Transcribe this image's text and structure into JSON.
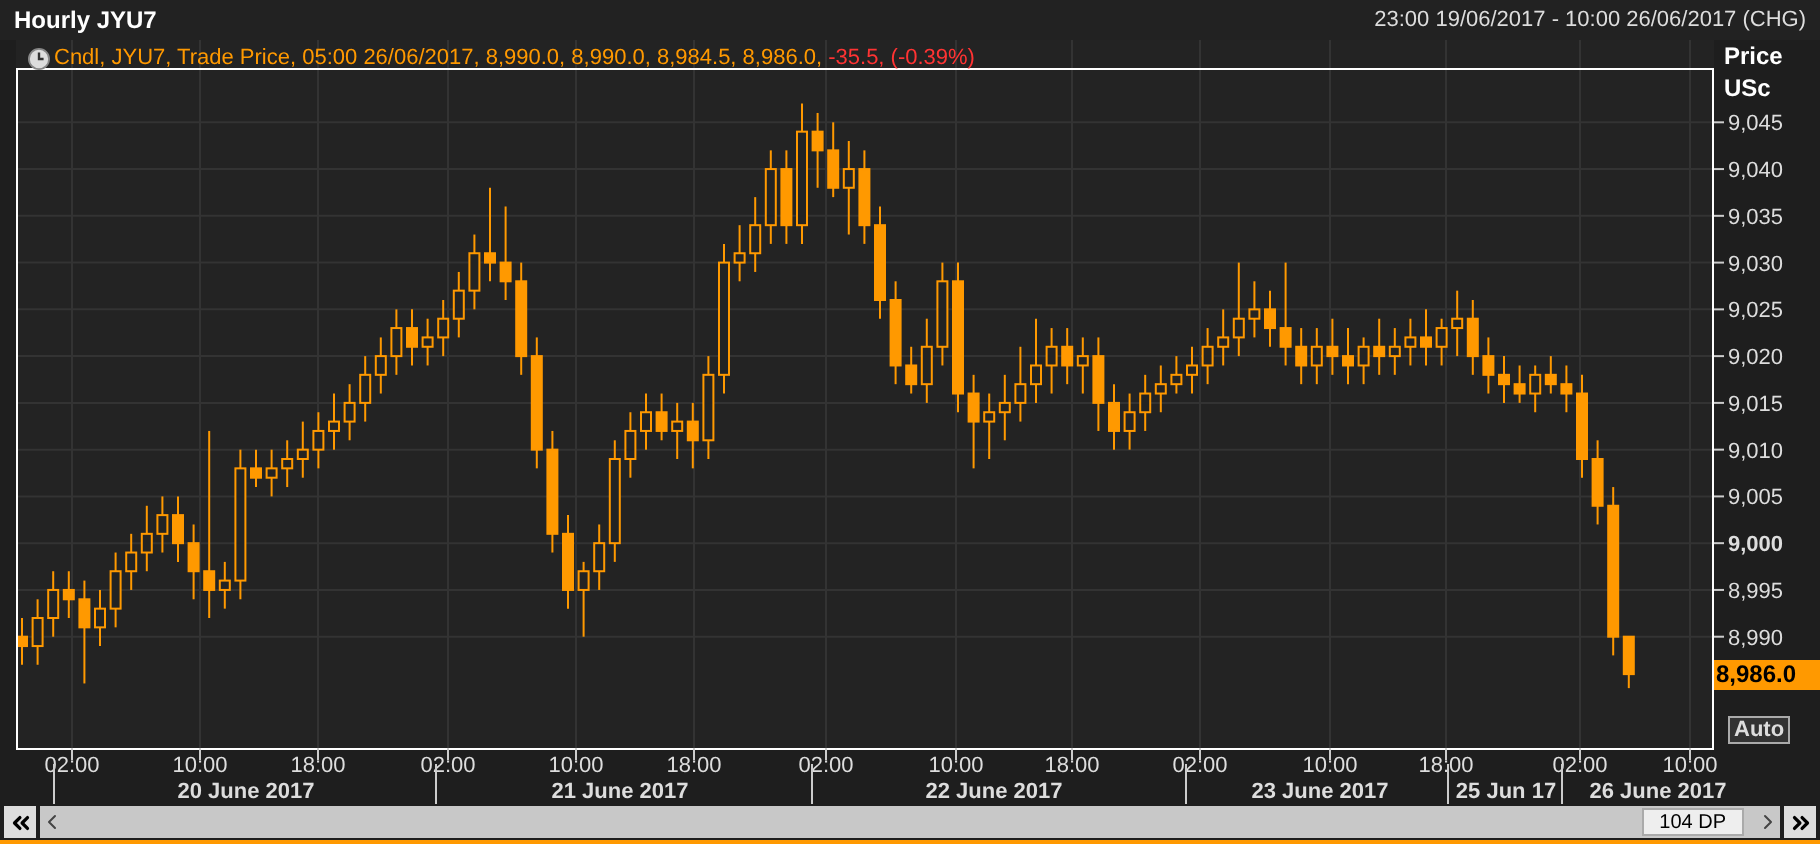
{
  "title": "Hourly JYU7",
  "range": "23:00 19/06/2017 - 10:00 26/06/2017 (CHG)",
  "legend": {
    "text": "Cndl, JYU7, Trade Price, 05:00 26/06/2017, 8,990.0, 8,990.0, 8,984.5, 8,986.0, ",
    "change": "-35.5, (-0.39%)"
  },
  "price_axis": {
    "title": "Price",
    "unit": "USc",
    "bold_ticks": [
      false,
      false,
      false,
      false,
      false,
      false,
      false,
      false,
      false,
      true,
      false,
      false
    ],
    "last_price": "8,986.0",
    "auto_button": "Auto"
  },
  "time_axis": {
    "times": [
      "02:00",
      "10:00",
      "18:00",
      "02:00",
      "10:00",
      "18:00",
      "02:00",
      "10:00",
      "18:00",
      "02:00",
      "10:00",
      "18:00",
      "02:00",
      "10:00"
    ],
    "dates": [
      "20 June 2017",
      "21 June 2017",
      "22 June 2017",
      "23 June 2017",
      "25 Jun 17",
      "26 June 2017"
    ]
  },
  "scrollbar": {
    "points": "104 DP"
  },
  "chart_data": {
    "type": "candlestick",
    "categories": [
      null,
      null,
      null,
      null,
      null,
      null,
      null,
      null,
      null,
      null,
      null,
      null,
      null,
      null,
      null,
      null,
      null,
      null,
      null,
      null,
      null,
      null,
      null,
      null,
      null,
      null,
      null,
      null,
      null,
      null,
      null,
      null,
      null,
      null,
      null,
      null,
      null,
      null,
      null,
      null,
      null,
      null,
      null,
      null,
      null,
      null,
      null,
      null,
      null,
      null,
      null,
      null,
      null,
      null,
      null,
      null,
      null,
      null,
      null,
      null,
      null,
      null,
      null,
      null,
      null,
      null,
      null,
      null,
      null,
      null,
      null,
      null,
      null,
      null,
      null,
      null,
      null,
      null,
      null,
      null,
      null,
      null,
      null,
      null,
      null,
      null,
      null,
      null,
      null,
      null,
      null,
      null,
      null,
      null,
      null,
      null,
      null,
      null,
      null,
      null,
      null,
      null,
      null,
      null
    ],
    "ylim": [
      8978.1,
      9053.8
    ],
    "grid": true,
    "yticks": [
      {
        "value": 9045,
        "label": "9,045"
      },
      {
        "value": 9040,
        "label": "9,040"
      },
      {
        "value": 9035,
        "label": "9,035"
      },
      {
        "value": 9030,
        "label": "9,030"
      },
      {
        "value": 9025,
        "label": "9,025"
      },
      {
        "value": 9020,
        "label": "9,020"
      },
      {
        "value": 9015,
        "label": "9,015"
      },
      {
        "value": 9010,
        "label": "9,010"
      },
      {
        "value": 9005,
        "label": "9,005"
      },
      {
        "value": 9000,
        "label": "9,000"
      },
      {
        "value": 8995,
        "label": "8,995"
      },
      {
        "value": 8990,
        "label": "8,990"
      }
    ],
    "ohlc": [
      [
        8990,
        8992,
        8987,
        8989
      ],
      [
        8989,
        8994,
        8987,
        8992
      ],
      [
        8992,
        8997,
        8990,
        8995
      ],
      [
        8995,
        8997,
        8992,
        8994
      ],
      [
        8994,
        8996,
        8985,
        8991
      ],
      [
        8991,
        8995,
        8989,
        8993
      ],
      [
        8993,
        8999,
        8991,
        8997
      ],
      [
        8997,
        9001,
        8995,
        8999
      ],
      [
        8999,
        9004,
        8997,
        9001
      ],
      [
        9001,
        9005,
        8999,
        9003
      ],
      [
        9003,
        9005,
        8998,
        9000
      ],
      [
        9000,
        9002,
        8994,
        8997
      ],
      [
        8997,
        9012,
        8992,
        8995
      ],
      [
        8995,
        8998,
        8993,
        8996
      ],
      [
        8996,
        9010,
        8994,
        9008
      ],
      [
        9008,
        9010,
        9006,
        9007
      ],
      [
        9007,
        9010,
        9005,
        9008
      ],
      [
        9008,
        9011,
        9006,
        9009
      ],
      [
        9009,
        9013,
        9007,
        9010
      ],
      [
        9010,
        9014,
        9008,
        9012
      ],
      [
        9012,
        9016,
        9010,
        9013
      ],
      [
        9013,
        9017,
        9011,
        9015
      ],
      [
        9015,
        9020,
        9013,
        9018
      ],
      [
        9018,
        9022,
        9016,
        9020
      ],
      [
        9020,
        9025,
        9018,
        9023
      ],
      [
        9023,
        9025,
        9019,
        9021
      ],
      [
        9021,
        9024,
        9019,
        9022
      ],
      [
        9022,
        9026,
        9020,
        9024
      ],
      [
        9024,
        9029,
        9022,
        9027
      ],
      [
        9027,
        9033,
        9025,
        9031
      ],
      [
        9031,
        9038,
        9028,
        9030
      ],
      [
        9030,
        9036,
        9026,
        9028
      ],
      [
        9028,
        9030,
        9018,
        9020
      ],
      [
        9020,
        9022,
        9008,
        9010
      ],
      [
        9010,
        9012,
        8999,
        9001
      ],
      [
        9001,
        9003,
        8993,
        8995
      ],
      [
        8995,
        8998,
        8990,
        8997
      ],
      [
        8997,
        9002,
        8995,
        9000
      ],
      [
        9000,
        9011,
        8998,
        9009
      ],
      [
        9009,
        9014,
        9007,
        9012
      ],
      [
        9012,
        9016,
        9010,
        9014
      ],
      [
        9014,
        9016,
        9011,
        9012
      ],
      [
        9012,
        9015,
        9009,
        9013
      ],
      [
        9013,
        9015,
        9008,
        9011
      ],
      [
        9011,
        9020,
        9009,
        9018
      ],
      [
        9018,
        9032,
        9016,
        9030
      ],
      [
        9030,
        9034,
        9028,
        9031
      ],
      [
        9031,
        9037,
        9029,
        9034
      ],
      [
        9034,
        9042,
        9032,
        9040
      ],
      [
        9040,
        9042,
        9032,
        9034
      ],
      [
        9034,
        9047,
        9032,
        9044
      ],
      [
        9044,
        9046,
        9038,
        9042
      ],
      [
        9042,
        9045,
        9037,
        9038
      ],
      [
        9038,
        9043,
        9033,
        9040
      ],
      [
        9040,
        9042,
        9032,
        9034
      ],
      [
        9034,
        9036,
        9024,
        9026
      ],
      [
        9026,
        9028,
        9017,
        9019
      ],
      [
        9019,
        9021,
        9016,
        9017
      ],
      [
        9017,
        9024,
        9015,
        9021
      ],
      [
        9021,
        9030,
        9019,
        9028
      ],
      [
        9028,
        9030,
        9014,
        9016
      ],
      [
        9016,
        9018,
        9008,
        9013
      ],
      [
        9013,
        9016,
        9009,
        9014
      ],
      [
        9014,
        9018,
        9011,
        9015
      ],
      [
        9015,
        9021,
        9013,
        9017
      ],
      [
        9017,
        9024,
        9015,
        9019
      ],
      [
        9019,
        9023,
        9016,
        9021
      ],
      [
        9021,
        9023,
        9017,
        9019
      ],
      [
        9019,
        9022,
        9016,
        9020
      ],
      [
        9020,
        9022,
        9012,
        9015
      ],
      [
        9015,
        9017,
        9010,
        9012
      ],
      [
        9012,
        9016,
        9010,
        9014
      ],
      [
        9014,
        9018,
        9012,
        9016
      ],
      [
        9016,
        9019,
        9014,
        9017
      ],
      [
        9017,
        9020,
        9016,
        9018
      ],
      [
        9018,
        9021,
        9016,
        9019
      ],
      [
        9019,
        9023,
        9017,
        9021
      ],
      [
        9021,
        9025,
        9019,
        9022
      ],
      [
        9022,
        9030,
        9020,
        9024
      ],
      [
        9024,
        9028,
        9022,
        9025
      ],
      [
        9025,
        9027,
        9021,
        9023
      ],
      [
        9023,
        9030,
        9019,
        9021
      ],
      [
        9021,
        9023,
        9017,
        9019
      ],
      [
        9019,
        9023,
        9017,
        9021
      ],
      [
        9021,
        9024,
        9018,
        9020
      ],
      [
        9020,
        9023,
        9017,
        9019
      ],
      [
        9019,
        9022,
        9017,
        9021
      ],
      [
        9021,
        9024,
        9018,
        9020
      ],
      [
        9020,
        9023,
        9018,
        9021
      ],
      [
        9021,
        9024,
        9019,
        9022
      ],
      [
        9022,
        9025,
        9019,
        9021
      ],
      [
        9021,
        9024,
        9019,
        9023
      ],
      [
        9023,
        9027,
        9020,
        9024
      ],
      [
        9024,
        9026,
        9018,
        9020
      ],
      [
        9020,
        9022,
        9016,
        9018
      ],
      [
        9018,
        9020,
        9015,
        9017
      ],
      [
        9017,
        9019,
        9015,
        9016
      ],
      [
        9016,
        9019,
        9014,
        9018
      ],
      [
        9018,
        9020,
        9016,
        9017
      ],
      [
        9017,
        9019,
        9014,
        9016
      ],
      [
        9016,
        9018,
        9007,
        9009
      ],
      [
        9009,
        9011,
        9002,
        9004
      ],
      [
        9004,
        9006,
        8988,
        8990
      ],
      [
        8990,
        8990,
        8984.5,
        8986
      ]
    ]
  }
}
